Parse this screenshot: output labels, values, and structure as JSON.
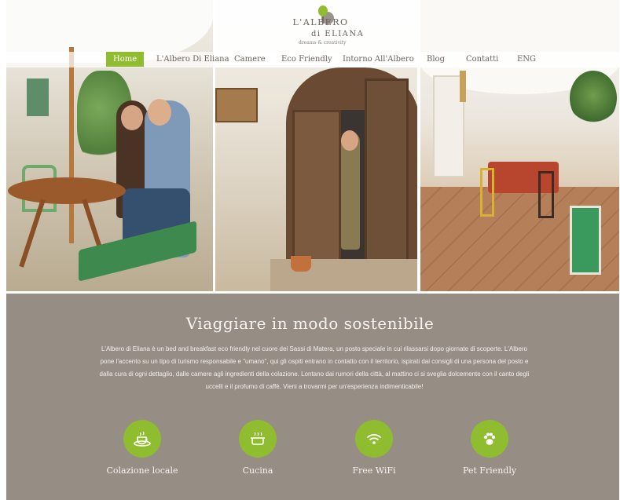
{
  "brand": {
    "name": "L'ALBERO",
    "name_sub": "di ELIANA",
    "tagline": "dreams & creativity"
  },
  "nav": {
    "items": [
      {
        "label": "Home",
        "active": true
      },
      {
        "label": "L'Albero Di Eliana",
        "active": false
      },
      {
        "label": "Camere",
        "active": false
      },
      {
        "label": "Eco Friendly",
        "active": false
      },
      {
        "label": "Intorno All'Albero",
        "active": false
      },
      {
        "label": "Blog",
        "active": false
      },
      {
        "label": "Contatti",
        "active": false
      },
      {
        "label": "ENG",
        "active": false
      }
    ]
  },
  "hero": {
    "photos": [
      "couple-in-garden",
      "woman-at-wooden-door",
      "kitchen-interior"
    ]
  },
  "intro": {
    "title": "Viaggiare in modo sostenibile",
    "paragraph": "L'Albero di Eliana è un bed and breakfast eco friendly nel cuore dei Sassi di Matera, un posto speciale in cui rilassarsi dopo giornate di scoperte. L'Albero pone l'accento su un tipo di turismo responsabile e \"umano\", qui gli ospiti entrano in contatto con il territorio, ispirati dai consigli di una persona del posto e dalla cura di ogni dettaglio, dalle camere agli ingredienti della colazione. Lontano dai rumori della città, al mattino ci si sveglia dolcemente con il canto degli uccelli e il profumo di caffè. Vieni a trovarmi per un'esperienza indimenticabile!"
  },
  "features": [
    {
      "label": "Colazione locale",
      "icon": "coffee-cup-icon"
    },
    {
      "label": "Cucina",
      "icon": "cooking-pot-icon"
    },
    {
      "label": "Free WiFi",
      "icon": "wifi-icon"
    },
    {
      "label": "Pet Friendly",
      "icon": "paw-icon"
    }
  ],
  "colors": {
    "accent": "#8fbd2f",
    "band": "#968d85",
    "nav_text": "#6c625b"
  }
}
